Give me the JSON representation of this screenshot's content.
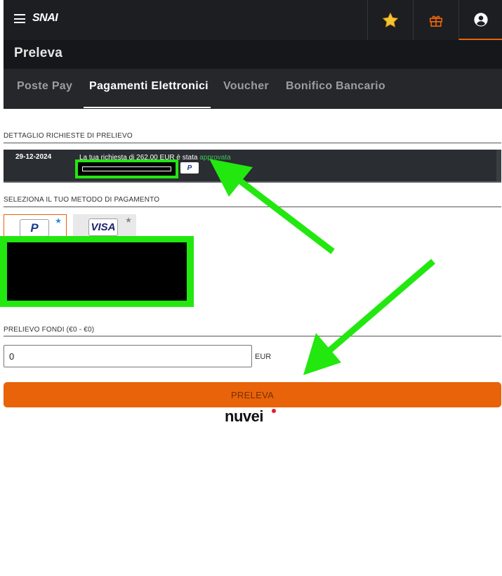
{
  "header": {
    "logo_text": "SNAI",
    "icons": [
      "menu-icon",
      "star-icon",
      "gift-icon",
      "user-icon"
    ]
  },
  "page_title": "Preleva",
  "tabs": [
    {
      "label": "Poste Pay",
      "active": false
    },
    {
      "label": "Pagamenti Elettronici",
      "active": true
    },
    {
      "label": "Voucher",
      "active": false
    },
    {
      "label": "Bonifico Bancario",
      "active": false
    }
  ],
  "requests_section": {
    "label": "DETTAGLIO RICHIESTE DI PRELIEVO",
    "row": {
      "date": "29-12-2024",
      "text": "La tua richiesta di 262.00 EUR è stata ",
      "status": "approvata",
      "method_badge": "P"
    }
  },
  "method_section": {
    "label": "SELEZIONA IL TUO METODO DI PAGAMENTO",
    "methods": [
      {
        "name": "P",
        "selected": true
      },
      {
        "name": "VISA",
        "selected": false
      }
    ]
  },
  "withdraw": {
    "label": "PRELIEVO FONDI (€0 - €0)",
    "value": "0",
    "currency": "EUR",
    "button_label": "PRELEVA"
  },
  "footer": {
    "provider": "nuvei"
  },
  "colors": {
    "accent": "#e8630a",
    "header_bg": "#1c1e21",
    "tabs_bg": "#25272b",
    "approved": "#3ec25c",
    "highlight": "#22e80f"
  }
}
